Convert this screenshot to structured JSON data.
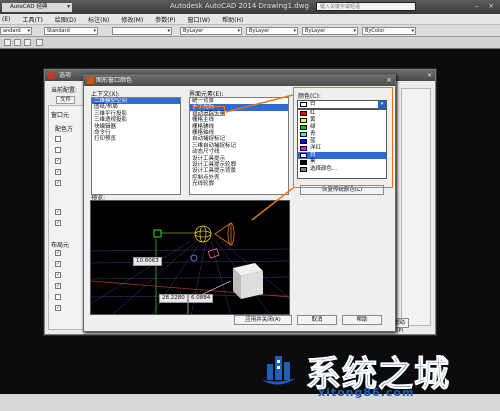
{
  "titlebar": {
    "workspace": "AutoCAD 经典",
    "title": "Autodesk AutoCAD 2014    Drawing1.dwg",
    "search_placeholder": "键入关键字或短语",
    "minimize": "–",
    "close": "×"
  },
  "menubar": {
    "items": [
      "(E)",
      "工具(T)",
      "绘图(D)",
      "标注(N)",
      "修改(M)",
      "参数(P)",
      "窗口(W)",
      "帮助(H)"
    ]
  },
  "toolbar": {
    "style_1": "andard",
    "style_2": "Standard",
    "layer": "",
    "linetype_1": "ByLayer",
    "linetype_2": "ByLayer",
    "lineweight": "ByLayer",
    "plotstyle": "ByColor"
  },
  "options_dialog": {
    "title": "选项",
    "close": "×",
    "current_profile": "当前配置:",
    "tab_file": "文件",
    "window_elements": "窗口元",
    "color_scheme": "配色方",
    "layout_elements": "布局元",
    "right_button": "帮助(P)"
  },
  "colors_dialog": {
    "title": "图形窗口颜色",
    "close": "×",
    "context_label": "上下文(X):",
    "context_items": [
      "二维模型空间",
      "图纸/布局",
      "三维平行投影",
      "三维透视投影",
      "块编辑器",
      "命令行",
      "打印预览"
    ],
    "context_selected": 0,
    "element_label": "界面元素(E):",
    "element_items": [
      "统一背景",
      "十字光标",
      "自动追踪矢量",
      "栅格主线",
      "栅格辅线",
      "栅格轴线",
      "自动捕捉标记",
      "三维自动捕捉标记",
      "动态尺寸线",
      "设计工具提示",
      "设计工具提示轮廓",
      "设计工具提示背景",
      "控制点外壳",
      "光线轮廓"
    ],
    "element_selected": 1,
    "color_label": "颜色(C):",
    "color_value": "白",
    "color_options": [
      {
        "name": "红",
        "swatch": "#ff0000"
      },
      {
        "name": "黄",
        "swatch": "#ffff00"
      },
      {
        "name": "绿",
        "swatch": "#00c000"
      },
      {
        "name": "青",
        "swatch": "#00ffff"
      },
      {
        "name": "蓝",
        "swatch": "#0000ff"
      },
      {
        "name": "洋红",
        "swatch": "#ff00ff"
      },
      {
        "name": "白",
        "swatch": "#ffffff"
      },
      {
        "name": "黑",
        "swatch": "#000000"
      },
      {
        "name": "选择颜色...",
        "swatch": "#808080"
      }
    ],
    "color_selected": 6,
    "restore_button": "恢复传统颜色(L)",
    "preview_label": "预览:",
    "preview_coords": [
      "10.6063",
      "28.2280",
      "6.0884"
    ],
    "apply_button": "应用并关闭(A)",
    "cancel_button": "取消",
    "help_button": "帮助"
  },
  "watermark": {
    "text": "系统之城",
    "url": "xitong86.com"
  },
  "colors": {
    "accent_orange": "#e8741b",
    "selection_blue": "#2e6bd6",
    "watermark_blue": "#1f5fb8"
  }
}
